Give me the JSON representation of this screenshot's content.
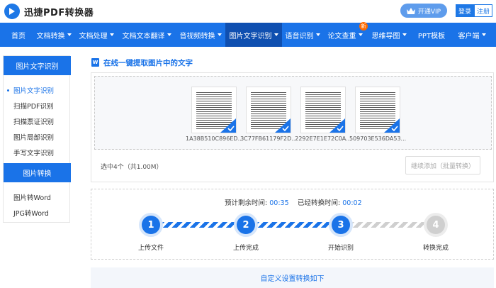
{
  "app": {
    "title": "迅捷PDF转换器",
    "vip_label": "开通VIP",
    "login_label": "登录",
    "register_label": "注册"
  },
  "nav": {
    "items": [
      {
        "label": "首页"
      },
      {
        "label": "文档转换"
      },
      {
        "label": "文档处理"
      },
      {
        "label": "文档文本翻译"
      },
      {
        "label": "音视频转换"
      },
      {
        "label": "图片文字识别"
      },
      {
        "label": "语音识别"
      },
      {
        "label": "论文查重",
        "badge": "新"
      },
      {
        "label": "思维导图"
      },
      {
        "label": "PPT模板"
      },
      {
        "label": "客户端"
      }
    ]
  },
  "sidebar": {
    "section1": {
      "title": "图片文字识别",
      "items": [
        "图片文字识别",
        "扫描PDF识别",
        "扫描票证识别",
        "图片局部识别",
        "手写文字识别"
      ]
    },
    "section2": {
      "title": "图片转换",
      "items": [
        "图片转Word",
        "JPG转Word"
      ]
    }
  },
  "main": {
    "title_icon": "W",
    "title": "在线一键提取图片中的文字",
    "files": [
      {
        "name": "1A38B510C896ED..."
      },
      {
        "name": "3C77FB61179F2D..."
      },
      {
        "name": "2292E7E1E72C0A..."
      },
      {
        "name": "509703E536DA53..."
      }
    ],
    "selected_info": "选中4个（共1.00M）",
    "continue_label": "继续添加（批量转换）"
  },
  "progress": {
    "remaining_label": "预计剩余时间:",
    "remaining_value": "00:35",
    "elapsed_label": "已经转换时间:",
    "elapsed_value": "00:02",
    "steps": [
      {
        "num": "1",
        "label": "上传文件"
      },
      {
        "num": "2",
        "label": "上传完成"
      },
      {
        "num": "3",
        "label": "开始识别"
      },
      {
        "num": "4",
        "label": "转换完成"
      }
    ],
    "current_step": 3
  },
  "settings": {
    "label": "自定义设置转换如下"
  },
  "colors": {
    "brand": "#1a73e8",
    "nav_active": "#0f4fb0",
    "badge": "#ff6a00"
  }
}
